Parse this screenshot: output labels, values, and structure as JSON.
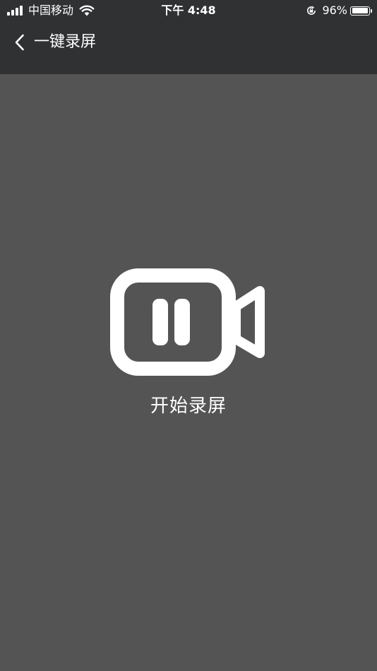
{
  "status_bar": {
    "carrier": "中国移动",
    "time": "下午 4:48",
    "battery_text": "96%",
    "battery_level": 0.96,
    "signal_bars": 4,
    "icons": [
      "signal-icon",
      "wifi-icon",
      "orientation-lock-icon",
      "battery-icon"
    ]
  },
  "nav": {
    "back_icon": "chevron-left-icon",
    "title": "一键录屏"
  },
  "main": {
    "record_icon": "video-camera-pause-icon",
    "record_label": "开始录屏"
  },
  "colors": {
    "header_background": "#2f3133",
    "page_background": "#545454",
    "foreground": "#ffffff"
  }
}
